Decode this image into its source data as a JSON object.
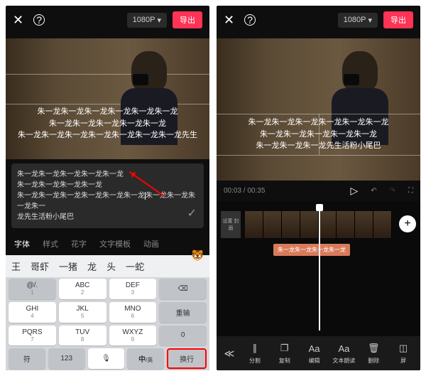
{
  "topbar": {
    "resolution": "1080P",
    "export": "导出"
  },
  "subtitles": {
    "l1": "朱一龙朱一龙朱一龙朱一龙朱一龙朱一龙",
    "l2": "朱一龙朱一龙朱一龙朱一龙朱一龙",
    "l3": "朱一龙朱一龙朱一龙朱一龙朱一龙朱一龙朱一龙先生"
  },
  "subtitles_r": {
    "l1": "朱一龙朱一龙朱一龙朱一龙朱一龙朱一龙",
    "l2": "朱一龙朱一龙朱一龙朱一龙朱一龙",
    "l3": "朱一龙朱一龙朱一龙先生活粉小尾巴"
  },
  "textinput": {
    "l1": "朱一龙朱一龙朱一龙朱一龙朱一龙",
    "l2": "朱一龙朱一龙朱一龙朱一龙",
    "l3a": "朱一龙朱一龙朱一龙朱一龙朱一龙朱一龙",
    "l3b": "朱一龙朱一龙朱一龙朱一",
    "l4": "龙先生活粉小尾巴"
  },
  "tabs": {
    "font": "字体",
    "style": "样式",
    "flower": "花字",
    "template": "文字模板",
    "anim": "动画"
  },
  "candidates": {
    "c1": "王",
    "c2": "哥虾",
    "c3": "一猪",
    "c4": "龙",
    "c5": "头",
    "c6": "一蛇"
  },
  "keys": {
    "at": "@/.",
    "n1": "1",
    "abc": "ABC",
    "n2": "2",
    "def": "DEF",
    "n3": "3",
    "ghi": "GHI",
    "n4": "4",
    "jkl": "JKL",
    "n5": "5",
    "mno": "MNO",
    "n6": "6",
    "redo": "重输",
    "pqrs": "PQRS",
    "n7": "7",
    "tuv": "TUV",
    "n8": "8",
    "wxyz": "WXYZ",
    "n9": "9",
    "zero": "0",
    "sym": "符",
    "num": "123",
    "mic": "🎤",
    "cn": "中",
    "en": "/英",
    "enter": "换行"
  },
  "time": {
    "cur": "00:03",
    "total": "00:35"
  },
  "cover_label": "设置\n封面",
  "track_label": "朱一龙朱一龙朱一龙朱一龙",
  "tools": {
    "split": "分割",
    "copy": "复制",
    "edit": "编辑",
    "read": "文本朗读",
    "delete": "删除",
    "screen": "屏"
  }
}
